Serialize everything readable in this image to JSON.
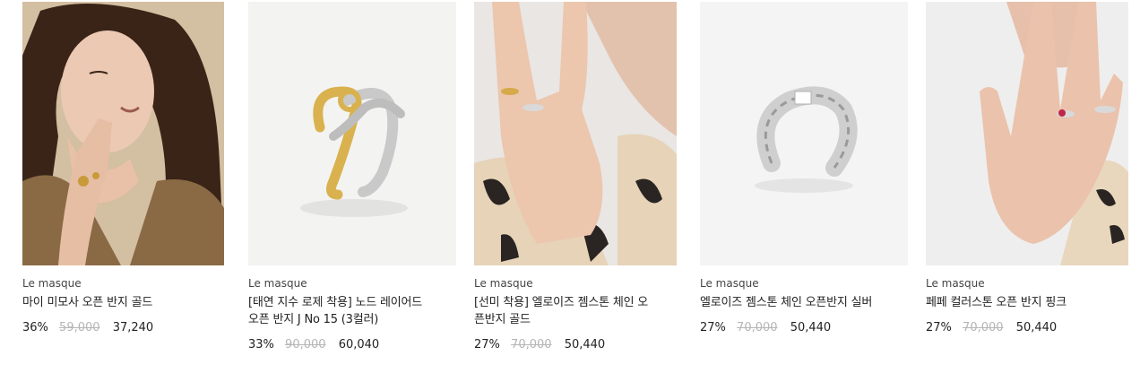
{
  "products": [
    {
      "image_desc_icon": "model-portrait-gold-ring",
      "brand": "Le masque",
      "title": "마이 미모사 오픈 반지 골드",
      "discount": "36%",
      "original_price": "59,000",
      "sale_price": "37,240"
    },
    {
      "image_desc_icon": "gold-silver-knot-ring",
      "brand": "Le masque",
      "title": "[태연 지수 로제 착용] 노드 레이어드 오픈 반지 J No 15 (3컬러)",
      "discount": "33%",
      "original_price": "90,000",
      "sale_price": "60,040"
    },
    {
      "image_desc_icon": "model-hand-chain-rings",
      "brand": "Le masque",
      "title": "[선미 착용] 엘로이즈 젬스톤 체인 오픈반지 골드",
      "discount": "27%",
      "original_price": "70,000",
      "sale_price": "50,440"
    },
    {
      "image_desc_icon": "silver-chain-ring",
      "brand": "Le masque",
      "title": "엘로이즈 젬스톤 체인 오픈반지 실버",
      "discount": "27%",
      "original_price": "70,000",
      "sale_price": "50,440"
    },
    {
      "image_desc_icon": "model-hand-pink-stone-ring",
      "brand": "Le masque",
      "title": "페페 컬러스톤 오픈 반지 핑크",
      "discount": "27%",
      "original_price": "70,000",
      "sale_price": "50,440"
    }
  ]
}
